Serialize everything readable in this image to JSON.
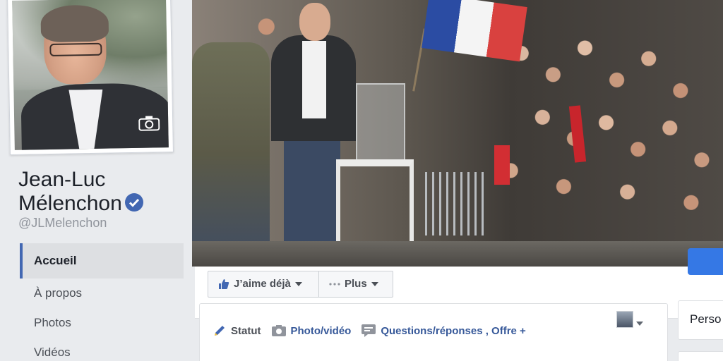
{
  "page": {
    "name": "Jean-Luc Mélenchon",
    "handle": "@JLMelenchon",
    "verified": true
  },
  "nav": {
    "items": [
      {
        "label": "Accueil",
        "active": true
      },
      {
        "label": "À propos",
        "active": false
      },
      {
        "label": "Photos",
        "active": false
      },
      {
        "label": "Vidéos",
        "active": false
      }
    ]
  },
  "actions": {
    "like_label": "J’aime déjà",
    "more_label": "Plus"
  },
  "composer": {
    "tabs": [
      {
        "label": "Statut",
        "icon": "pencil-icon"
      },
      {
        "label": "Photo/vidéo",
        "icon": "camera-icon"
      },
      {
        "label": "Questions/réponses , Offre +",
        "icon": "speech-bubble-icon"
      }
    ]
  },
  "right": {
    "card_label": "Perso"
  },
  "colors": {
    "accent": "#4267b2",
    "link": "#365899",
    "background": "#e9ebee",
    "cta_blue": "#3578e5"
  }
}
